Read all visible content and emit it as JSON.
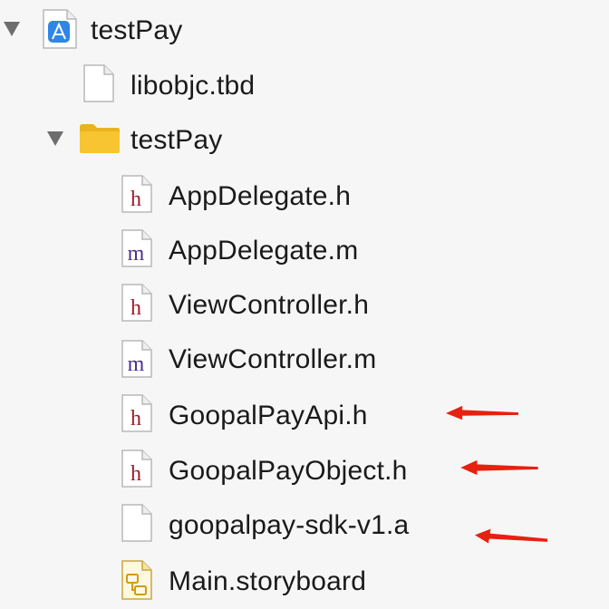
{
  "navigator": {
    "items": [
      {
        "label": "testPay",
        "icon": "xcode-project-icon",
        "expanded": true
      },
      {
        "label": "libobjc.tbd",
        "icon": "blank-file-icon"
      },
      {
        "label": "testPay",
        "icon": "folder-icon",
        "expanded": true
      },
      {
        "label": "AppDelegate.h",
        "icon": "header-file-icon",
        "glyph": "h"
      },
      {
        "label": "AppDelegate.m",
        "icon": "objc-file-icon",
        "glyph": "m"
      },
      {
        "label": "ViewController.h",
        "icon": "header-file-icon",
        "glyph": "h"
      },
      {
        "label": "ViewController.m",
        "icon": "objc-file-icon",
        "glyph": "m"
      },
      {
        "label": "GoopalPayApi.h",
        "icon": "header-file-icon",
        "glyph": "h"
      },
      {
        "label": "GoopalPayObject.h",
        "icon": "header-file-icon",
        "glyph": "h"
      },
      {
        "label": "goopalpay-sdk-v1.a",
        "icon": "blank-file-icon"
      },
      {
        "label": "Main.storyboard",
        "icon": "storyboard-file-icon"
      }
    ]
  },
  "annotation_color": "#e8200f",
  "colors": {
    "header_glyph": "#9b1c2a",
    "objc_glyph": "#4b2d8f",
    "folder": "#f7c531",
    "project": "#2f86e6"
  }
}
